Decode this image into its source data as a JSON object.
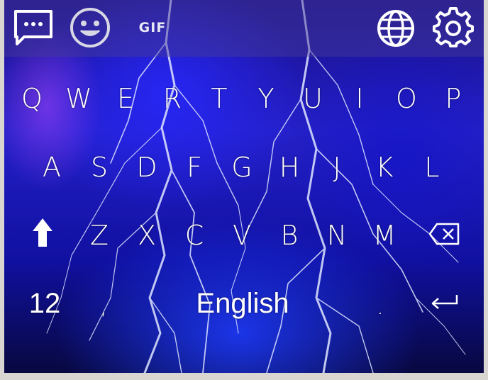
{
  "toolbar": {
    "chat_icon": "chat-dots-icon",
    "emoji_icon": "smiley-icon",
    "gif_label": "GIF",
    "language_icon": "globe-icon",
    "settings_icon": "gear-icon"
  },
  "keyboard": {
    "row1": [
      "Q",
      "W",
      "E",
      "R",
      "T",
      "Y",
      "U",
      "I",
      "O",
      "P"
    ],
    "row2": [
      "A",
      "S",
      "D",
      "F",
      "G",
      "H",
      "J",
      "K",
      "L"
    ],
    "row3": [
      "Z",
      "X",
      "C",
      "V",
      "B",
      "N",
      "M"
    ],
    "shift_icon": "shift-arrow-icon",
    "backspace_icon": "backspace-icon",
    "numbers_label": "12",
    "comma_label": ",",
    "space_label": "English",
    "period_label": ".",
    "enter_icon": "enter-arrow-icon"
  },
  "colors": {
    "background_primary": "#2420c8",
    "key_text": "#ffffff",
    "toolbar_overlay": "#463c96"
  }
}
